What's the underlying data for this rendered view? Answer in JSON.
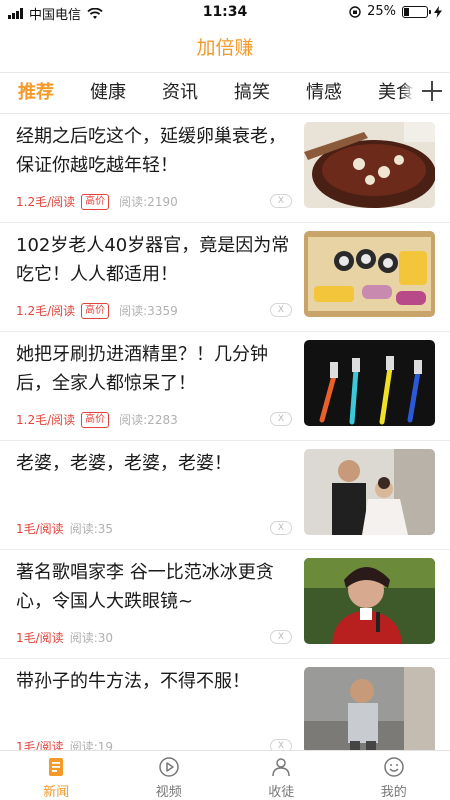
{
  "status_bar": {
    "carrier": "中国电信",
    "time": "11:34",
    "battery_percent": "25%",
    "battery_level": 0.25
  },
  "app": {
    "title": "加倍赚"
  },
  "tabs": [
    {
      "label": "推荐",
      "active": true
    },
    {
      "label": "健康"
    },
    {
      "label": "资讯"
    },
    {
      "label": "搞笑"
    },
    {
      "label": "情感"
    },
    {
      "label": "美食"
    }
  ],
  "articles": [
    {
      "title": "经期之后吃这个，延缓卵巢衰老，保证你越吃越年轻！",
      "rate": "1.2毛/阅读",
      "tag": "高价",
      "reads": "阅读:2190",
      "image": "dessert-bowl-photo"
    },
    {
      "title": "102岁老人40岁器官，竟是因为常吃它！人人都适用！",
      "rate": "1.2毛/阅读",
      "tag": "高价",
      "reads": "阅读:3359",
      "image": "sushi-corn-platter-photo"
    },
    {
      "title": "她把牙刷扔进酒精里？！几分钟后，全家人都惊呆了！",
      "rate": "1.2毛/阅读",
      "tag": "高价",
      "reads": "阅读:2283",
      "image": "toothbrushes-photo"
    },
    {
      "title": "老婆，老婆，老婆，老婆！",
      "rate": "1毛/阅读",
      "reads": "阅读:35",
      "image": "couple-photo"
    },
    {
      "title": "著名歌唱家李 谷一比范冰冰更贪心，令国人大跌眼镜~",
      "rate": "1毛/阅读",
      "reads": "阅读:30",
      "image": "singer-photo"
    },
    {
      "title": "带孙子的牛方法，不得不服！",
      "rate": "1毛/阅读",
      "reads": "阅读:19",
      "image": "child-photo"
    }
  ],
  "dismiss_label": "X",
  "bottom_nav": [
    {
      "label": "新闻",
      "icon": "news-icon",
      "active": true
    },
    {
      "label": "视频",
      "icon": "video-play-icon"
    },
    {
      "label": "收徒",
      "icon": "users-icon"
    },
    {
      "label": "我的",
      "icon": "smile-profile-icon"
    }
  ],
  "colors": {
    "accent": "#f39a2b",
    "price_red": "#e0443a",
    "muted": "#b0b0b0"
  }
}
